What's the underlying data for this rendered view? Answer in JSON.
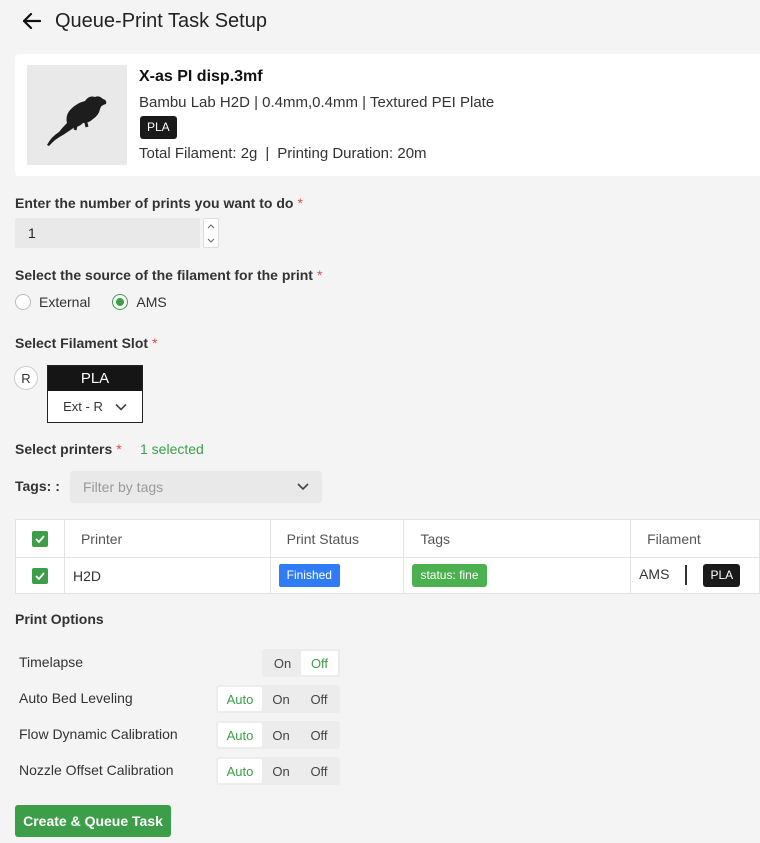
{
  "header": {
    "title": "Queue-Print Task Setup"
  },
  "model": {
    "name": "X-as PI disp.3mf",
    "specs": "Bambu Lab H2D | 0.4mm,0.4mm | Textured PEI Plate",
    "material_badge": "PLA",
    "total_filament": "Total Filament: 2g",
    "separator": "|",
    "duration": "Printing Duration: 20m"
  },
  "prints": {
    "label": "Enter the number of prints you want to do",
    "required": "*",
    "value": "1"
  },
  "source": {
    "label": "Select the source of the filament for the print",
    "required": "*",
    "options": [
      {
        "label": "External",
        "checked": false
      },
      {
        "label": "AMS",
        "checked": true
      }
    ]
  },
  "slot": {
    "label": "Select Filament Slot",
    "required": "*",
    "circle": "R",
    "material": "PLA",
    "selected": "Ext - R"
  },
  "printers": {
    "label": "Select printers",
    "required": "*",
    "selected_count": "1 selected",
    "tags_label": "Tags: :",
    "tags_placeholder": "Filter by tags",
    "columns": [
      "Printer",
      "Print Status",
      "Tags",
      "Filament"
    ],
    "rows": [
      {
        "printer": "H2D",
        "status": "Finished",
        "tag": "status: fine",
        "filament_source": "AMS",
        "filament": "PLA"
      }
    ]
  },
  "print_options": {
    "title": "Print Options",
    "options": [
      {
        "label": "Timelapse",
        "choices": [
          "On",
          "Off"
        ],
        "selected": "Off"
      },
      {
        "label": "Auto Bed Leveling",
        "choices": [
          "Auto",
          "On",
          "Off"
        ],
        "selected": "Auto"
      },
      {
        "label": "Flow Dynamic Calibration",
        "choices": [
          "Auto",
          "On",
          "Off"
        ],
        "selected": "Auto"
      },
      {
        "label": "Nozzle Offset Calibration",
        "choices": [
          "Auto",
          "On",
          "Off"
        ],
        "selected": "Auto"
      }
    ]
  },
  "actions": {
    "create_label": "Create & Queue Task"
  },
  "colors": {
    "accent": "#3c9e48",
    "status_blue": "#2f7cf6",
    "tag_green": "#4caf50",
    "required": "#e5484d"
  }
}
